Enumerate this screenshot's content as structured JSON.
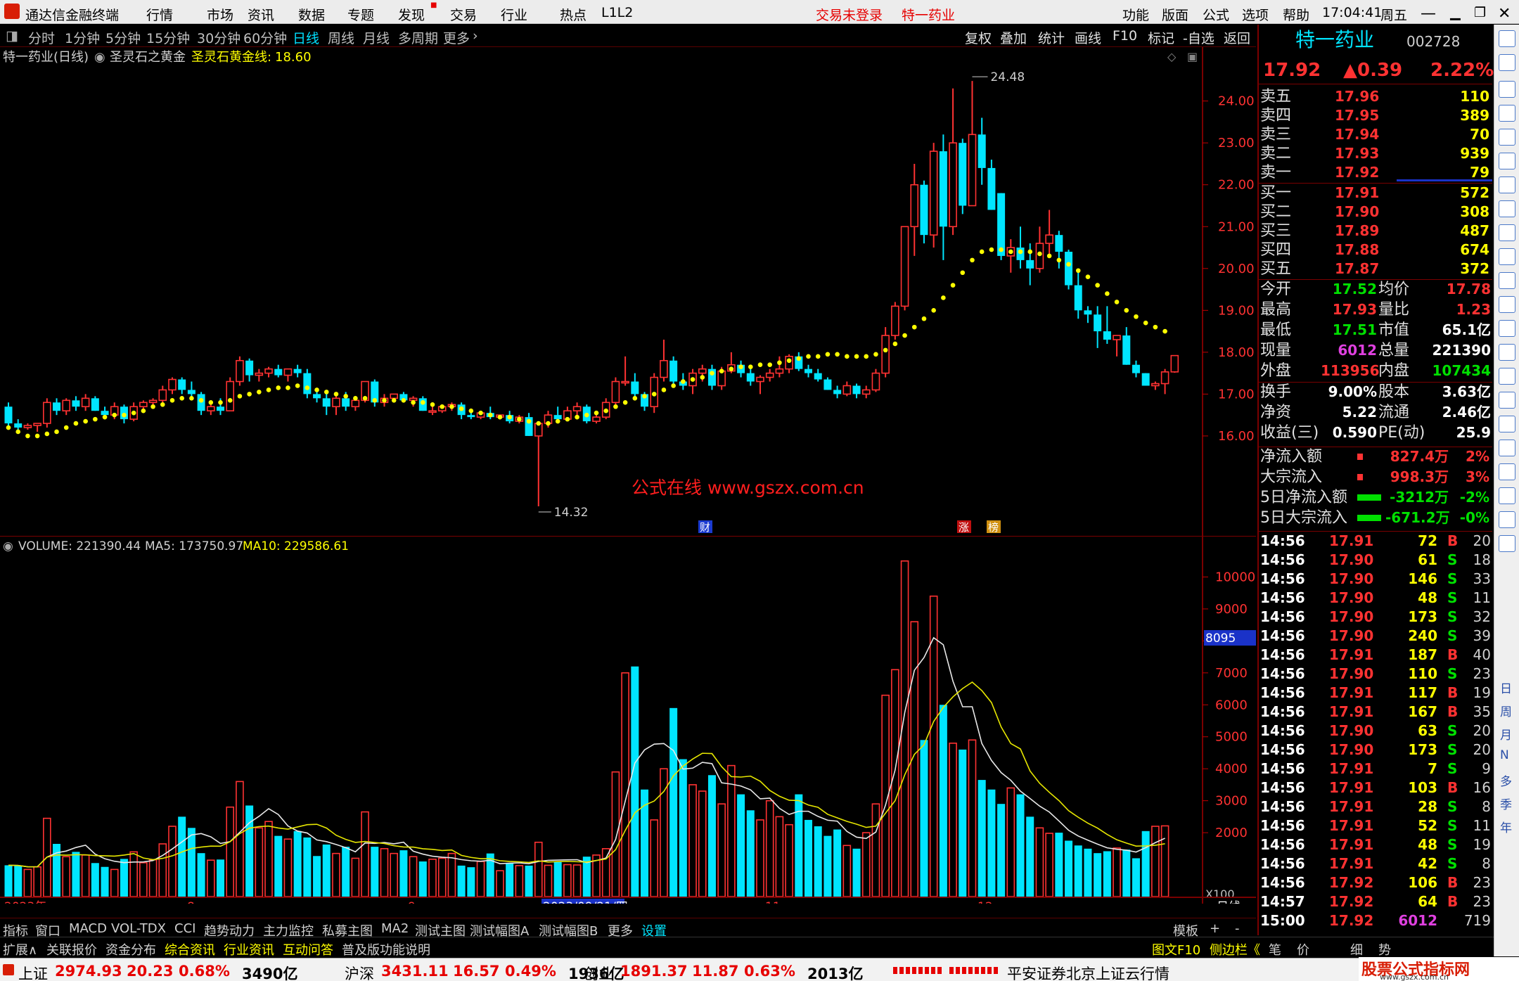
{
  "window": {
    "app_title": "通达信金融终端",
    "menu": [
      "行情",
      "市场",
      "资讯",
      "数据",
      "专题",
      "发现",
      "交易",
      "行业",
      "热点",
      "L1L2"
    ],
    "login_status": "交易未登录",
    "stock_title": "特一药业",
    "right_menu": [
      "功能",
      "版面",
      "公式",
      "选项",
      "帮助"
    ],
    "time": "17:04:41",
    "weekday": "周五"
  },
  "period_tabs": [
    "分时",
    "1分钟",
    "5分钟",
    "15分钟",
    "30分钟",
    "60分钟",
    "日线",
    "周线",
    "月线",
    "多周期",
    "更多"
  ],
  "selected_period": "日线",
  "tool_buttons": [
    "复权",
    "叠加",
    "统计",
    "画线",
    "F10",
    "标记",
    "-自选",
    "返回"
  ],
  "chart_header": {
    "name": "特一药业(日线)",
    "indicator": "圣灵石之黄金",
    "line_label": "圣灵石黄金线:",
    "line_value": "18.60"
  },
  "price_axis": [
    "24.00",
    "23.00",
    "22.00",
    "21.00",
    "20.00",
    "19.00",
    "18.00",
    "17.00",
    "16.00"
  ],
  "max_label": "24.48",
  "min_label": "14.32",
  "watermark": "公式在线  www.gszx.com.cn",
  "event_markers": [
    "财",
    "涨",
    "榜"
  ],
  "volume_header": {
    "label": "VOLUME: 221390.44",
    "ma5": "MA5: 173750.97",
    "ma10": "MA10: 229586.61"
  },
  "volume_axis": [
    "10000",
    "9000",
    "8000",
    "7000",
    "6000",
    "5000",
    "4000",
    "3000",
    "2000"
  ],
  "volume_marker": "8095",
  "volume_unit": "X100",
  "date_axis": [
    "2023年",
    "8",
    "9",
    "2023/09/21/四",
    "11",
    "12",
    "日线"
  ],
  "bottom_tabs": [
    "指标",
    "窗口",
    "MACD",
    "VOL-TDX",
    "CCI",
    "趋势动力",
    "主力监控",
    "私募主图",
    "MA2",
    "测试主图",
    "测试幅图A",
    "测试幅图B",
    "更多",
    "设置",
    "模板",
    "+",
    "-"
  ],
  "info_tabs": [
    "扩展∧",
    "关联报价",
    "资金分布",
    "综合资讯",
    "行业资讯",
    "互动问答",
    "普及版功能说明"
  ],
  "info_right": [
    "图文F10",
    "侧边栏《",
    "笔",
    "价",
    "细",
    "势"
  ],
  "quote": {
    "name": "特一药业",
    "code": "002728",
    "price": "17.92",
    "change": "▲0.39",
    "pct": "2.22%",
    "asks": [
      {
        "label": "卖五",
        "price": "17.96",
        "vol": "110"
      },
      {
        "label": "卖四",
        "price": "17.95",
        "vol": "389"
      },
      {
        "label": "卖三",
        "price": "17.94",
        "vol": "70"
      },
      {
        "label": "卖二",
        "price": "17.93",
        "vol": "939"
      },
      {
        "label": "卖一",
        "price": "17.92",
        "vol": "79"
      }
    ],
    "bids": [
      {
        "label": "买一",
        "price": "17.91",
        "vol": "572"
      },
      {
        "label": "买二",
        "price": "17.90",
        "vol": "308"
      },
      {
        "label": "买三",
        "price": "17.89",
        "vol": "487"
      },
      {
        "label": "买四",
        "price": "17.88",
        "vol": "674"
      },
      {
        "label": "买五",
        "price": "17.87",
        "vol": "372"
      }
    ],
    "stats": [
      [
        "今开",
        "17.52",
        "均价",
        "17.78"
      ],
      [
        "最高",
        "17.93",
        "量比",
        "1.23"
      ],
      [
        "最低",
        "17.51",
        "市值",
        "65.1亿"
      ],
      [
        "现量",
        "6012",
        "总量",
        "221390"
      ],
      [
        "外盘",
        "113956",
        "内盘",
        "107434"
      ]
    ],
    "stats2": [
      [
        "换手",
        "9.00%",
        "股本",
        "3.63亿"
      ],
      [
        "净资",
        "5.22",
        "流通",
        "2.46亿"
      ],
      [
        "收益(三)",
        "0.590",
        "PE(动)",
        "25.9"
      ]
    ],
    "flows": [
      [
        "净流入额",
        "827.4万",
        "2%"
      ],
      [
        "大宗流入",
        "998.3万",
        "3%"
      ],
      [
        "5日净流入额",
        "-3212万",
        "-2%"
      ],
      [
        "5日大宗流入",
        "-671.2万",
        "-0%"
      ]
    ],
    "ticks": [
      [
        "14:56",
        "17.91",
        "72",
        "B",
        "20"
      ],
      [
        "14:56",
        "17.90",
        "61",
        "S",
        "18"
      ],
      [
        "14:56",
        "17.90",
        "146",
        "S",
        "33"
      ],
      [
        "14:56",
        "17.90",
        "48",
        "S",
        "11"
      ],
      [
        "14:56",
        "17.90",
        "173",
        "S",
        "32"
      ],
      [
        "14:56",
        "17.90",
        "240",
        "S",
        "39"
      ],
      [
        "14:56",
        "17.91",
        "187",
        "B",
        "40"
      ],
      [
        "14:56",
        "17.90",
        "110",
        "S",
        "23"
      ],
      [
        "14:56",
        "17.91",
        "117",
        "B",
        "19"
      ],
      [
        "14:56",
        "17.91",
        "167",
        "B",
        "35"
      ],
      [
        "14:56",
        "17.90",
        "63",
        "S",
        "20"
      ],
      [
        "14:56",
        "17.90",
        "173",
        "S",
        "20"
      ],
      [
        "14:56",
        "17.91",
        "7",
        "S",
        "9"
      ],
      [
        "14:56",
        "17.91",
        "103",
        "B",
        "16"
      ],
      [
        "14:56",
        "17.91",
        "28",
        "S",
        "8"
      ],
      [
        "14:56",
        "17.91",
        "52",
        "S",
        "11"
      ],
      [
        "14:56",
        "17.91",
        "48",
        "S",
        "19"
      ],
      [
        "14:56",
        "17.91",
        "42",
        "S",
        "8"
      ],
      [
        "14:56",
        "17.92",
        "106",
        "B",
        "23"
      ],
      [
        "14:57",
        "17.92",
        "64",
        "B",
        "23"
      ],
      [
        "15:00",
        "17.92",
        "6012",
        "",
        "719"
      ]
    ]
  },
  "side_labels": [
    "日",
    "周",
    "月",
    "N",
    "多",
    "季",
    "年"
  ],
  "status": [
    {
      "name": "上证",
      "val": "2974.93",
      "chg": "20.23",
      "pct": "0.68%",
      "amt": "3490亿"
    },
    {
      "name": "沪深",
      "val": "3431.11",
      "chg": "16.57",
      "pct": "0.49%",
      "amt": "1936亿"
    },
    {
      "name": "创业",
      "val": "1891.37",
      "chg": "11.87",
      "pct": "0.63%",
      "amt": "2013亿"
    }
  ],
  "status_right": "平安证券北京上证云行情",
  "brand_logo": "股票公式指标网",
  "brand_url": "www.gszx.com.cn",
  "colors": {
    "up": "#ff3232",
    "down": "#00e5ff",
    "gold": "#ffff00",
    "bg": "#000000"
  },
  "chart_data": {
    "type": "candlestick",
    "candles": [
      [
        16.7,
        16.8,
        16.2,
        16.3
      ],
      [
        16.3,
        16.4,
        16.1,
        16.2
      ],
      [
        16.2,
        16.3,
        16.15,
        16.25
      ],
      [
        16.25,
        16.3,
        16.1,
        16.3
      ],
      [
        16.3,
        16.9,
        16.2,
        16.8
      ],
      [
        16.8,
        16.9,
        16.5,
        16.6
      ],
      [
        16.6,
        16.9,
        16.5,
        16.85
      ],
      [
        16.85,
        16.95,
        16.6,
        16.7
      ],
      [
        16.7,
        17.0,
        16.6,
        16.9
      ],
      [
        16.9,
        16.95,
        16.6,
        16.6
      ],
      [
        16.6,
        16.7,
        16.4,
        16.5
      ],
      [
        16.5,
        16.8,
        16.4,
        16.7
      ],
      [
        16.7,
        16.75,
        16.3,
        16.4
      ],
      [
        16.4,
        16.8,
        16.35,
        16.7
      ],
      [
        16.7,
        16.85,
        16.6,
        16.8
      ],
      [
        16.8,
        16.9,
        16.7,
        16.85
      ],
      [
        16.85,
        17.2,
        16.8,
        17.1
      ],
      [
        17.1,
        17.4,
        17.0,
        17.35
      ],
      [
        17.35,
        17.4,
        17.0,
        17.1
      ],
      [
        17.1,
        17.3,
        16.9,
        17.0
      ],
      [
        17.0,
        17.05,
        16.5,
        16.6
      ],
      [
        16.6,
        16.8,
        16.5,
        16.7
      ],
      [
        16.7,
        16.9,
        16.5,
        16.6
      ],
      [
        16.6,
        17.4,
        16.6,
        17.3
      ],
      [
        17.3,
        17.9,
        17.2,
        17.8
      ],
      [
        17.8,
        17.85,
        17.3,
        17.45
      ],
      [
        17.45,
        17.6,
        17.3,
        17.5
      ],
      [
        17.5,
        17.65,
        17.4,
        17.6
      ],
      [
        17.6,
        17.7,
        17.4,
        17.45
      ],
      [
        17.45,
        17.5,
        17.3,
        17.6
      ],
      [
        17.6,
        17.7,
        17.4,
        17.5
      ],
      [
        17.5,
        17.6,
        16.9,
        17.0
      ],
      [
        17.0,
        17.1,
        16.8,
        16.9
      ],
      [
        16.9,
        17.1,
        16.5,
        16.7
      ],
      [
        16.7,
        17.0,
        16.5,
        16.9
      ],
      [
        16.9,
        17.05,
        16.6,
        16.7
      ],
      [
        16.7,
        16.95,
        16.6,
        16.85
      ],
      [
        16.85,
        17.2,
        16.8,
        17.3
      ],
      [
        17.3,
        17.35,
        16.7,
        16.8
      ],
      [
        16.8,
        17.0,
        16.7,
        16.9
      ],
      [
        16.9,
        17.0,
        16.8,
        17.0
      ],
      [
        17.0,
        17.05,
        16.8,
        16.85
      ],
      [
        16.85,
        16.95,
        16.7,
        16.9
      ],
      [
        16.9,
        16.95,
        16.6,
        16.6
      ],
      [
        16.6,
        16.7,
        16.5,
        16.6
      ],
      [
        16.6,
        16.75,
        16.55,
        16.7
      ],
      [
        16.7,
        16.8,
        16.6,
        16.75
      ],
      [
        16.75,
        16.8,
        16.4,
        16.5
      ],
      [
        16.5,
        16.6,
        16.4,
        16.45
      ],
      [
        16.45,
        16.6,
        16.4,
        16.55
      ],
      [
        16.55,
        16.7,
        16.4,
        16.45
      ],
      [
        16.45,
        16.5,
        16.4,
        16.5
      ],
      [
        16.5,
        16.6,
        16.3,
        16.35
      ],
      [
        16.35,
        16.5,
        16.3,
        16.45
      ],
      [
        16.45,
        16.55,
        16.0,
        16.0
      ],
      [
        16.0,
        16.3,
        14.32,
        16.3
      ],
      [
        16.3,
        16.6,
        16.2,
        16.5
      ],
      [
        16.5,
        16.7,
        16.35,
        16.4
      ],
      [
        16.4,
        16.7,
        16.35,
        16.6
      ],
      [
        16.6,
        16.8,
        16.5,
        16.7
      ],
      [
        16.7,
        16.75,
        16.3,
        16.35
      ],
      [
        16.35,
        16.5,
        16.3,
        16.45
      ],
      [
        16.45,
        16.9,
        16.4,
        16.8
      ],
      [
        16.8,
        17.4,
        16.75,
        17.3
      ],
      [
        17.3,
        17.9,
        17.2,
        17.3
      ],
      [
        17.3,
        17.5,
        16.9,
        17.0
      ],
      [
        17.0,
        17.05,
        16.6,
        16.7
      ],
      [
        16.7,
        17.5,
        16.55,
        17.4
      ],
      [
        17.4,
        18.3,
        17.3,
        17.8
      ],
      [
        17.8,
        17.9,
        17.2,
        17.3
      ],
      [
        17.3,
        17.5,
        17.1,
        17.2
      ],
      [
        17.2,
        17.6,
        17.0,
        17.5
      ],
      [
        17.5,
        17.7,
        17.3,
        17.6
      ],
      [
        17.6,
        17.7,
        17.1,
        17.2
      ],
      [
        17.2,
        17.65,
        17.1,
        17.55
      ],
      [
        17.55,
        18.0,
        17.5,
        17.7
      ],
      [
        17.7,
        17.8,
        17.4,
        17.5
      ],
      [
        17.5,
        17.6,
        17.2,
        17.3
      ],
      [
        17.3,
        17.45,
        17.0,
        17.4
      ],
      [
        17.4,
        17.6,
        17.3,
        17.5
      ],
      [
        17.5,
        17.9,
        17.4,
        17.6
      ],
      [
        17.6,
        17.95,
        17.5,
        17.9
      ],
      [
        17.9,
        18.0,
        17.55,
        17.6
      ],
      [
        17.6,
        17.7,
        17.4,
        17.5
      ],
      [
        17.5,
        17.6,
        17.3,
        17.35
      ],
      [
        17.35,
        17.4,
        17.1,
        17.1
      ],
      [
        17.1,
        17.2,
        16.9,
        17.0
      ],
      [
        17.0,
        17.3,
        16.95,
        17.2
      ],
      [
        17.2,
        17.25,
        16.9,
        17.0
      ],
      [
        17.0,
        17.2,
        16.9,
        17.1
      ],
      [
        17.1,
        17.6,
        17.05,
        17.5
      ],
      [
        17.5,
        18.6,
        17.4,
        18.4
      ],
      [
        18.4,
        19.2,
        18.3,
        19.1
      ],
      [
        19.1,
        21.0,
        19.0,
        21.0
      ],
      [
        21.0,
        22.5,
        20.3,
        22.0
      ],
      [
        22.0,
        22.1,
        20.6,
        20.8
      ],
      [
        20.8,
        23.0,
        20.5,
        22.8
      ],
      [
        22.8,
        23.2,
        20.2,
        21.0
      ],
      [
        21.0,
        24.3,
        20.8,
        23.0
      ],
      [
        23.0,
        23.1,
        21.3,
        21.5
      ],
      [
        21.5,
        24.48,
        21.6,
        23.2
      ],
      [
        23.2,
        23.6,
        22.0,
        22.4
      ],
      [
        22.4,
        22.6,
        21.4,
        21.4
      ],
      [
        21.8,
        21.8,
        20.2,
        20.3
      ],
      [
        20.3,
        20.7,
        19.9,
        20.5
      ],
      [
        20.5,
        21.0,
        20.0,
        20.2
      ],
      [
        20.2,
        20.6,
        19.6,
        20.0
      ],
      [
        20.0,
        21.0,
        19.9,
        20.6
      ],
      [
        20.6,
        21.4,
        20.3,
        20.8
      ],
      [
        20.8,
        20.9,
        20.0,
        20.4
      ],
      [
        20.4,
        20.45,
        19.5,
        19.6
      ],
      [
        19.6,
        19.9,
        18.8,
        19.0
      ],
      [
        19.0,
        19.1,
        18.7,
        18.9
      ],
      [
        18.9,
        19.1,
        18.1,
        18.5
      ],
      [
        18.5,
        19.1,
        18.2,
        18.3
      ],
      [
        18.3,
        18.4,
        17.9,
        18.4
      ],
      [
        18.4,
        18.6,
        17.7,
        17.7
      ],
      [
        17.7,
        17.8,
        17.4,
        17.5
      ],
      [
        17.5,
        17.5,
        17.2,
        17.2
      ],
      [
        17.2,
        17.3,
        17.1,
        17.25
      ],
      [
        17.25,
        17.6,
        17.0,
        17.53
      ],
      [
        17.53,
        17.93,
        17.51,
        17.92
      ]
    ],
    "gold_line": [
      16.2,
      16.1,
      16.0,
      16.0,
      16.05,
      16.1,
      16.2,
      16.3,
      16.35,
      16.4,
      16.45,
      16.5,
      16.5,
      16.55,
      16.6,
      16.7,
      16.75,
      16.85,
      16.9,
      16.9,
      16.85,
      16.8,
      16.8,
      16.85,
      16.95,
      17.0,
      17.05,
      17.1,
      17.15,
      17.15,
      17.2,
      17.15,
      17.1,
      17.05,
      17.0,
      16.95,
      16.9,
      16.9,
      16.85,
      16.85,
      16.85,
      16.85,
      16.8,
      16.8,
      16.75,
      16.7,
      16.7,
      16.65,
      16.6,
      16.55,
      16.5,
      16.45,
      16.45,
      16.4,
      16.35,
      16.3,
      16.3,
      16.35,
      16.4,
      16.45,
      16.5,
      16.55,
      16.6,
      16.7,
      16.8,
      16.9,
      16.95,
      17.0,
      17.1,
      17.2,
      17.3,
      17.35,
      17.4,
      17.5,
      17.55,
      17.6,
      17.65,
      17.65,
      17.7,
      17.7,
      17.75,
      17.8,
      17.85,
      17.9,
      17.9,
      17.95,
      17.95,
      17.9,
      17.9,
      17.9,
      17.95,
      18.05,
      18.2,
      18.4,
      18.6,
      18.8,
      19.0,
      19.3,
      19.6,
      19.9,
      20.2,
      20.4,
      20.45,
      20.45,
      20.4,
      20.4,
      20.4,
      20.35,
      20.3,
      20.2,
      20.1,
      19.95,
      19.8,
      19.6,
      19.4,
      19.2,
      19.0,
      18.85,
      18.7,
      18.6,
      18.5
    ],
    "volumes": [
      980,
      970,
      850,
      930,
      2450,
      1650,
      1250,
      1400,
      1300,
      1050,
      930,
      850,
      1180,
      1400,
      1060,
      1150,
      1650,
      2200,
      2500,
      2150,
      1360,
      1140,
      1160,
      2800,
      3600,
      2850,
      2150,
      2350,
      1900,
      1800,
      2050,
      1850,
      1270,
      1630,
      1350,
      1560,
      1200,
      2650,
      1560,
      1500,
      1350,
      1450,
      1250,
      1100,
      1170,
      1200,
      1350,
      970,
      920,
      1100,
      1350,
      810,
      1050,
      970,
      970,
      1700,
      980,
      1100,
      1000,
      990,
      1250,
      1300,
      1500,
      3900,
      7000,
      7200,
      3350,
      2400,
      4000,
      5900,
      4300,
      3500,
      3300,
      3800,
      2900,
      4100,
      3200,
      2700,
      2400,
      3000,
      2500,
      2250,
      3200,
      2400,
      2200,
      1900,
      2100,
      1600,
      1500,
      2000,
      2900,
      6300,
      7100,
      10500,
      8600,
      4900,
      9400,
      6000,
      4800,
      4600,
      4900,
      3650,
      3350,
      2900,
      3400,
      3200,
      2500,
      2150,
      1980,
      2000,
      1750,
      1600,
      1500,
      1360,
      1420,
      1520,
      1470,
      1200,
      2050,
      2200,
      2213
    ]
  }
}
